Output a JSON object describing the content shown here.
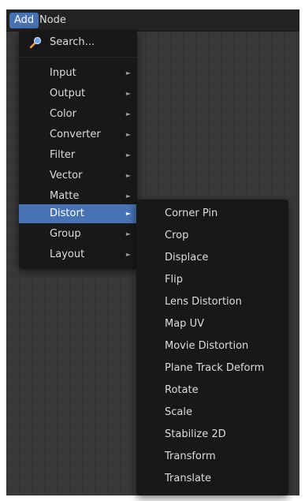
{
  "header": {
    "add_label": "Add",
    "node_label": "Node"
  },
  "add_menu": {
    "search_label": "Search...",
    "items": [
      {
        "label": "Input",
        "has_submenu": true
      },
      {
        "label": "Output",
        "has_submenu": true
      },
      {
        "label": "Color",
        "has_submenu": true
      },
      {
        "label": "Converter",
        "has_submenu": true
      },
      {
        "label": "Filter",
        "has_submenu": true
      },
      {
        "label": "Vector",
        "has_submenu": true
      },
      {
        "label": "Matte",
        "has_submenu": true
      },
      {
        "label": "Distort",
        "has_submenu": true,
        "highlighted": true
      },
      {
        "label": "Group",
        "has_submenu": true
      },
      {
        "label": "Layout",
        "has_submenu": true
      }
    ],
    "submenu_arrow": "►"
  },
  "distort_submenu": {
    "items": [
      "Corner Pin",
      "Crop",
      "Displace",
      "Flip",
      "Lens Distortion",
      "Map UV",
      "Movie Distortion",
      "Plane Track Deform",
      "Rotate",
      "Scale",
      "Stabilize 2D",
      "Transform",
      "Translate"
    ]
  },
  "colors": {
    "accent": "#4772b3",
    "editor_bg": "#393939",
    "menu_bg": "#181818",
    "text": "#dcdcdc"
  },
  "icons": {
    "search": "search-icon",
    "submenu_arrow": "triangle-right-icon"
  }
}
